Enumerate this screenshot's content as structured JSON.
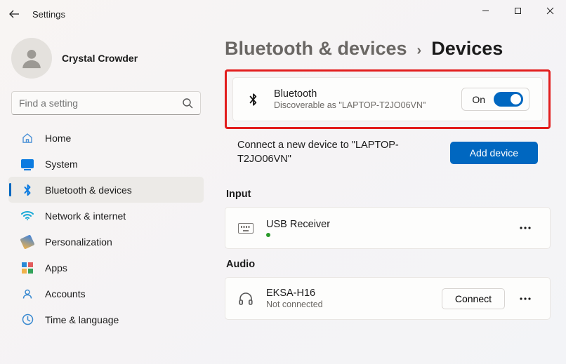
{
  "app": {
    "title": "Settings"
  },
  "profile": {
    "name": "Crystal Crowder"
  },
  "search": {
    "placeholder": "Find a setting"
  },
  "nav": {
    "items": [
      {
        "label": "Home"
      },
      {
        "label": "System"
      },
      {
        "label": "Bluetooth & devices"
      },
      {
        "label": "Network & internet"
      },
      {
        "label": "Personalization"
      },
      {
        "label": "Apps"
      },
      {
        "label": "Accounts"
      },
      {
        "label": "Time & language"
      }
    ]
  },
  "breadcrumb": {
    "parent": "Bluetooth & devices",
    "chevron": "›",
    "current": "Devices"
  },
  "bluetooth": {
    "title": "Bluetooth",
    "subtitle": "Discoverable as \"LAPTOP-T2JO06VN\"",
    "toggle_label": "On"
  },
  "add_device": {
    "text": "Connect a new device to \"LAPTOP-T2JO06VN\"",
    "button": "Add device"
  },
  "sections": {
    "input": {
      "heading": "Input",
      "items": [
        {
          "title": "USB Receiver"
        }
      ]
    },
    "audio": {
      "heading": "Audio",
      "items": [
        {
          "title": "EKSA-H16",
          "status": "Not connected",
          "action": "Connect"
        }
      ]
    }
  }
}
